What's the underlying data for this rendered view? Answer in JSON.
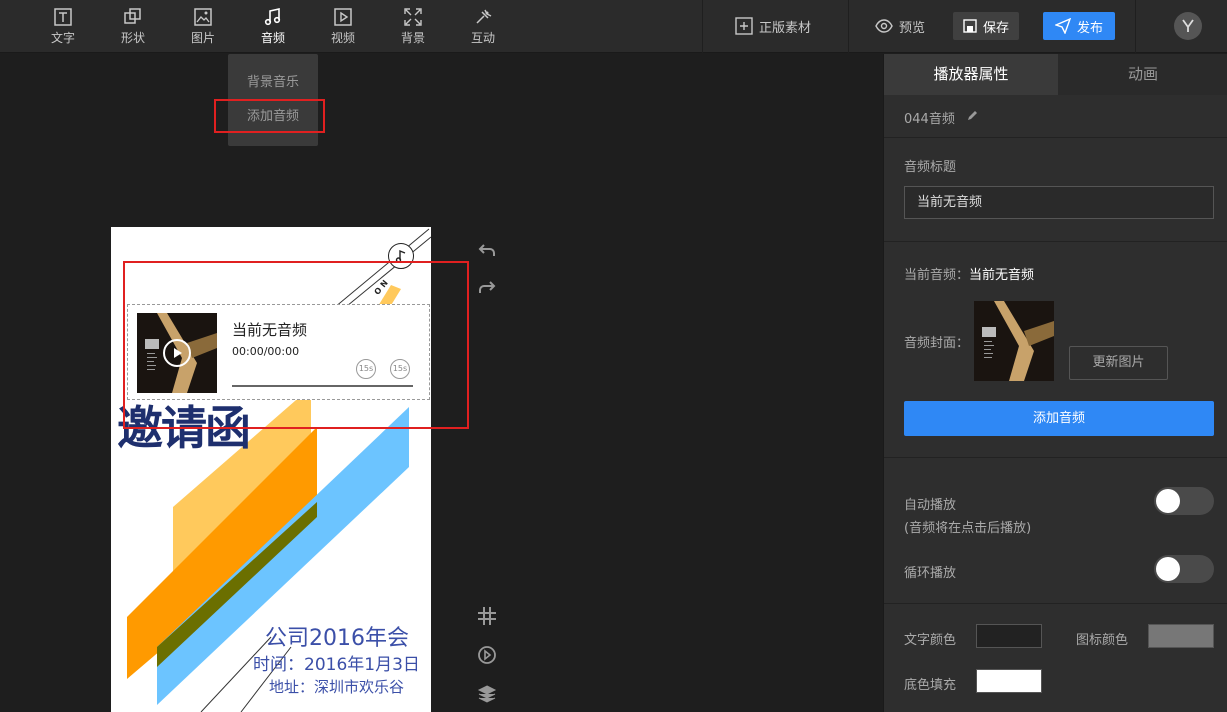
{
  "toolbar": {
    "tools": [
      {
        "label": "文字",
        "icon": "text-icon"
      },
      {
        "label": "形状",
        "icon": "shape-icon"
      },
      {
        "label": "图片",
        "icon": "image-icon"
      },
      {
        "label": "音频",
        "icon": "music-note-icon",
        "active": true
      },
      {
        "label": "视频",
        "icon": "video-icon"
      },
      {
        "label": "背景",
        "icon": "background-icon"
      },
      {
        "label": "互动",
        "icon": "interactive-icon"
      }
    ],
    "stock": "正版素材",
    "preview": "预览",
    "save": "保存",
    "publish": "发布",
    "accent": "#2f88f5"
  },
  "audio_menu": {
    "items": [
      "背景音乐",
      "添加音频"
    ],
    "highlighted": "添加音频"
  },
  "canvas": {
    "player": {
      "title": "当前无音频",
      "time": "00:00/00:00",
      "skip_back": "15s",
      "skip_forward": "15s"
    },
    "invite_text": "邀请函",
    "event_title": "公司2016年会",
    "event_time": "时间：2016年1月3日",
    "event_location": "地址：深圳市欢乐谷",
    "corner_text": "O N",
    "text_color": "#3b4fa8"
  },
  "panel": {
    "tabs": [
      "播放器属性",
      "动画"
    ],
    "component_name": "044音频",
    "audio_title_label": "音频标题",
    "audio_title_value": "当前无音频",
    "current_audio_label": "当前音频：",
    "current_audio_value": "当前无音频",
    "cover_label": "音频封面：",
    "update_image": "更新图片",
    "add_audio": "添加音频",
    "autoplay_label": "自动播放",
    "autoplay_note": "(音频将在点击后播放)",
    "autoplay_on": false,
    "loop_label": "循环播放",
    "loop_on": false,
    "text_color_label": "文字颜色",
    "text_color_value": "#222222",
    "icon_color_label": "图标颜色",
    "icon_color_value": "#777777",
    "bg_fill_label": "底色填充",
    "bg_fill_value": "#ffffff"
  }
}
